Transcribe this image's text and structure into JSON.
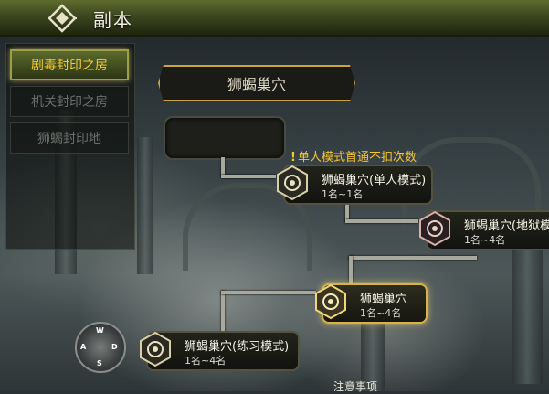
{
  "header": {
    "title": "副本",
    "logo_icon": "diamond-emblem-icon"
  },
  "tabs": [
    {
      "label": "剧毒封印之房",
      "state": "active"
    },
    {
      "label": "机关封印之房",
      "state": "disabled"
    },
    {
      "label": "狮蝎封印地",
      "state": "disabled"
    }
  ],
  "dungeon": {
    "title": "狮蝎巢穴"
  },
  "notice": {
    "icon": "exclamation-icon",
    "text": "单人模式首通不扣次数"
  },
  "nodes": [
    {
      "name": "狮蝎巢穴(单人模式)",
      "count": "1名~1名",
      "icon": "scorpion-emblem-icon"
    },
    {
      "name": "狮蝎巢穴(地狱模",
      "count": "1名~4名",
      "icon": "scorpion-emblem-icon"
    },
    {
      "name": "狮蝎巢穴",
      "count": "1名~4名",
      "icon": "scorpion-emblem-icon",
      "state": "active"
    },
    {
      "name": "狮蝎巢穴(练习模式)",
      "count": "1名~4名",
      "icon": "scorpion-emblem-icon"
    }
  ],
  "compass": {
    "w": "W",
    "a": "A",
    "s": "S",
    "d": "D"
  },
  "footer": {
    "note": "注意事项"
  },
  "colors": {
    "accent": "#f3c938",
    "header": "#3d4720",
    "border_active": "#d4b44c"
  }
}
